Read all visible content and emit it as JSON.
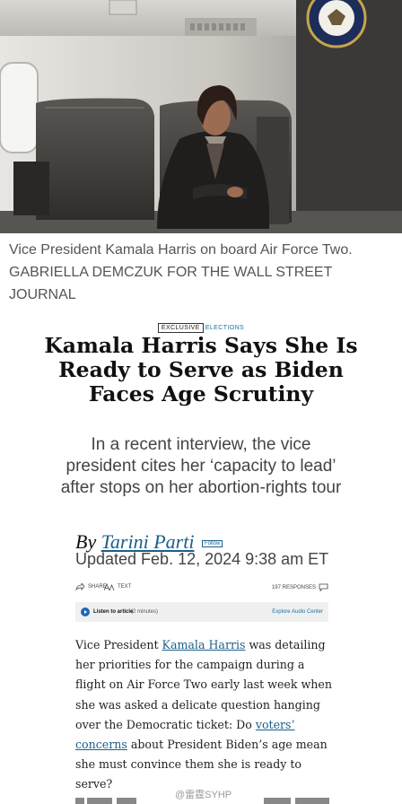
{
  "photo": {
    "alt": "Vice President Kamala Harris seated in a cabin seat aboard Air Force Two"
  },
  "caption": {
    "text": "Vice President Kamala Harris on board Air Force Two.",
    "credit": "GABRIELLA DEMCZUK FOR THE WALL STREET JOURNAL"
  },
  "article": {
    "tag_exclusive": "EXCLUSIVE",
    "tag_section": "ELECTIONS",
    "headline": "Kamala Harris Says She Is Ready to Serve as Biden Faces Age Scrutiny",
    "dek": "In a recent interview, the vice president cites her ‘capacity to lead’ after stops on her abortion-rights tour",
    "byline_prefix": "By",
    "author": "Tarini Parti",
    "follow_label": "Follow",
    "updated": "Updated Feb. 12, 2024 9:38 am ET"
  },
  "toolbar": {
    "share": "SHARE",
    "text": "TEXT",
    "responses": "197 RESPONSES"
  },
  "audio": {
    "listen": "Listen to article",
    "duration": "(2 minutes)",
    "explore": "Explore Audio Center"
  },
  "body": {
    "p1_a": "Vice President ",
    "p1_link1": "Kamala Harris",
    "p1_b": " was detailing her priorities for the campaign during a flight on Air Force Two early last week when she was asked a delicate question hanging over the Democratic ticket: Do ",
    "p1_link2": "voters’ concerns",
    "p1_c": " about President Biden’s age mean she must convince them she is ready to serve?"
  },
  "watermark": "@雷霆SYHP",
  "colors": {
    "link": "#1a5f8a",
    "accent": "#1a73a6",
    "audio_play": "#1d68b8"
  }
}
